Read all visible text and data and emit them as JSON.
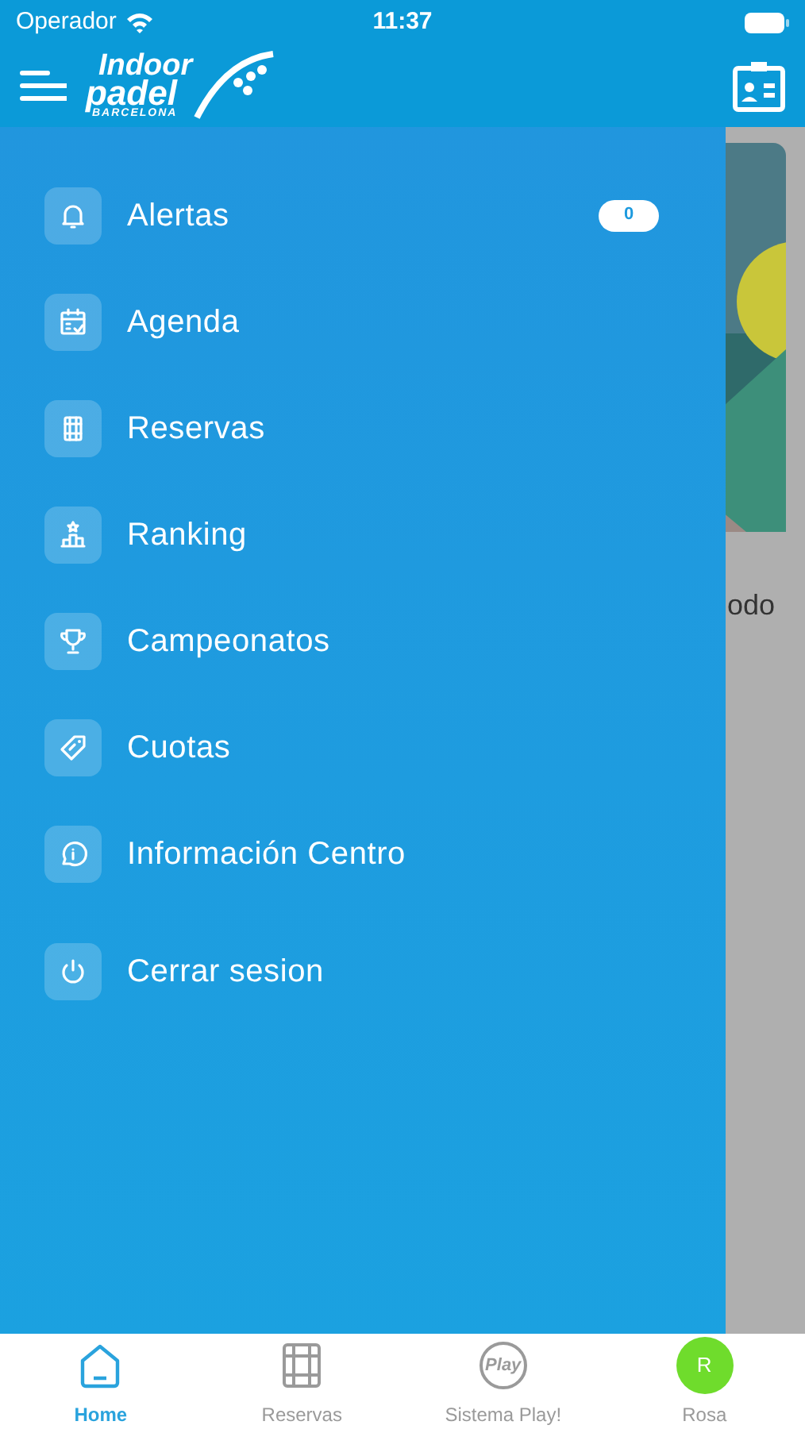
{
  "status_bar": {
    "carrier": "Operador",
    "time": "11:37"
  },
  "header": {
    "logo": {
      "line_1": "Indoor",
      "line_2": "padel",
      "line_3": "BARCELONA"
    }
  },
  "background": {
    "card_text": "odo"
  },
  "menu": [
    {
      "label": "Alertas",
      "badge": "0"
    },
    {
      "label": "Agenda"
    },
    {
      "label": "Reservas"
    },
    {
      "label": "Ranking"
    },
    {
      "label": "Campeonatos"
    },
    {
      "label": "Cuotas"
    },
    {
      "label": "Información Centro"
    },
    {
      "label": "Cerrar sesion"
    }
  ],
  "tab_bar": [
    {
      "label": "Home",
      "selected": true
    },
    {
      "label": "Reservas",
      "selected": false
    },
    {
      "label": "Sistema Play!",
      "selected": false,
      "icon_text": "Play"
    },
    {
      "label": "Rosa",
      "selected": false,
      "avatar": "R"
    }
  ]
}
